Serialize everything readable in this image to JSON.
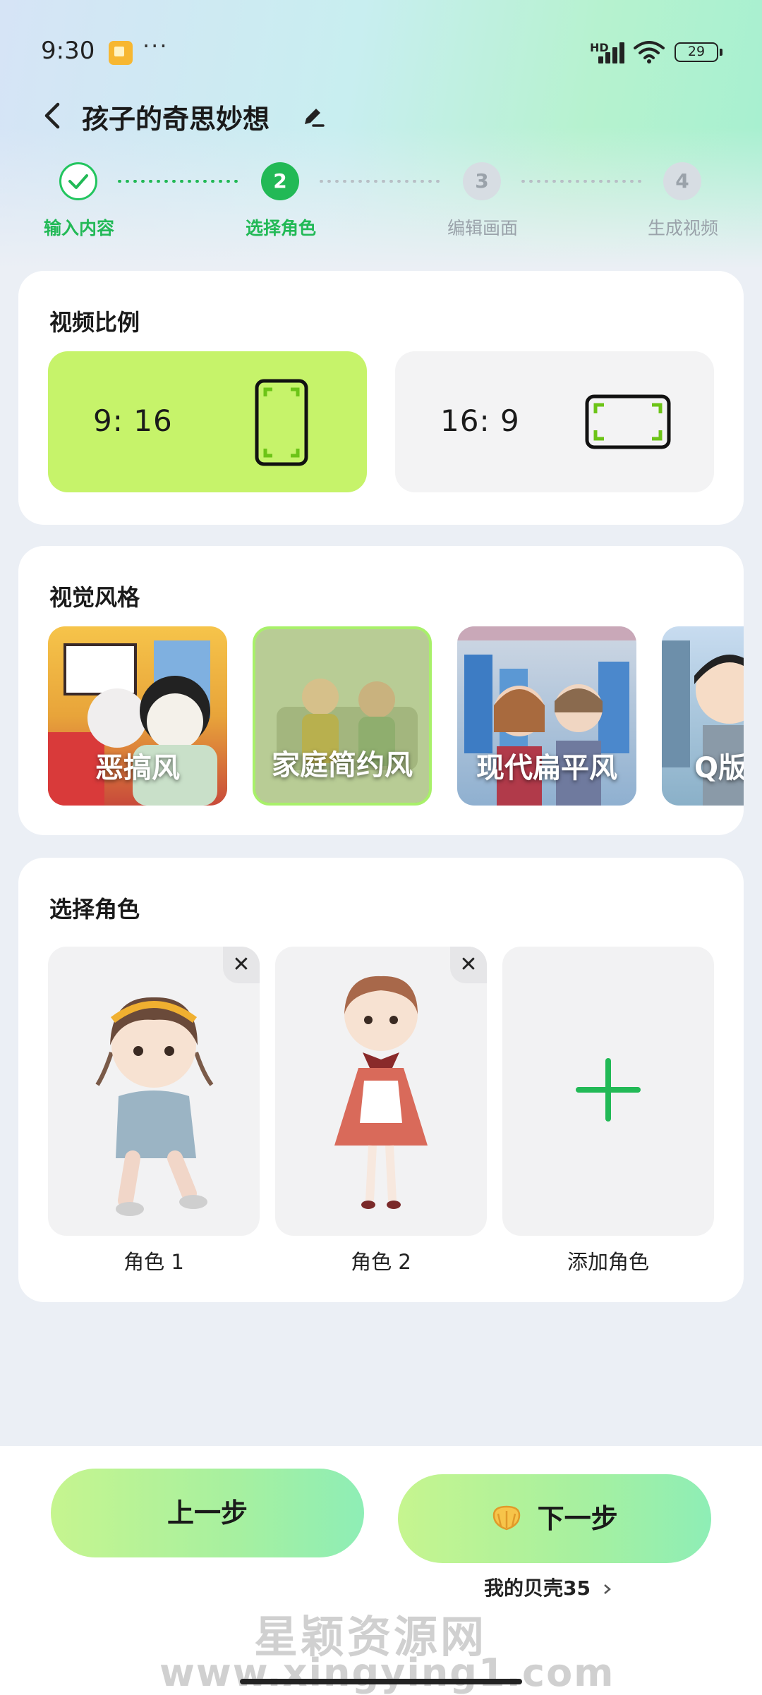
{
  "status_bar": {
    "time": "9:30",
    "more": "···",
    "network": "HD",
    "battery": "29"
  },
  "header": {
    "title": "孩子的奇思妙想"
  },
  "stepper": {
    "steps": [
      {
        "number": "",
        "label": "输入内容",
        "state": "done"
      },
      {
        "number": "2",
        "label": "选择角色",
        "state": "active"
      },
      {
        "number": "3",
        "label": "编辑画面",
        "state": "todo"
      },
      {
        "number": "4",
        "label": "生成视频",
        "state": "todo"
      }
    ]
  },
  "video_ratio": {
    "title": "视频比例",
    "options": [
      {
        "label": "9: 16",
        "selected": true
      },
      {
        "label": "16: 9",
        "selected": false
      }
    ]
  },
  "visual_style": {
    "title": "视觉风格",
    "options": [
      {
        "label": "恶搞风",
        "selected": false
      },
      {
        "label": "家庭简约风",
        "selected": true
      },
      {
        "label": "现代扁平风",
        "selected": false
      },
      {
        "label": "Q版",
        "selected": false
      }
    ]
  },
  "characters": {
    "title": "选择角色",
    "items": [
      {
        "label": "角色 1"
      },
      {
        "label": "角色 2"
      }
    ],
    "add_label": "添加角色",
    "close_glyph": "✕",
    "add_glyph": "+"
  },
  "actions": {
    "prev_label": "上一步",
    "next_label": "下一步",
    "shell_balance": "我的贝壳35"
  },
  "watermark": {
    "line1": "星颖资源网",
    "line2": "www.xingying1.com"
  },
  "colors": {
    "accent_green": "#22b956",
    "selected_ratio_bg": "#c6f36a",
    "button_gradient_start": "#c6f58f",
    "button_gradient_end": "#8eeeb6"
  }
}
